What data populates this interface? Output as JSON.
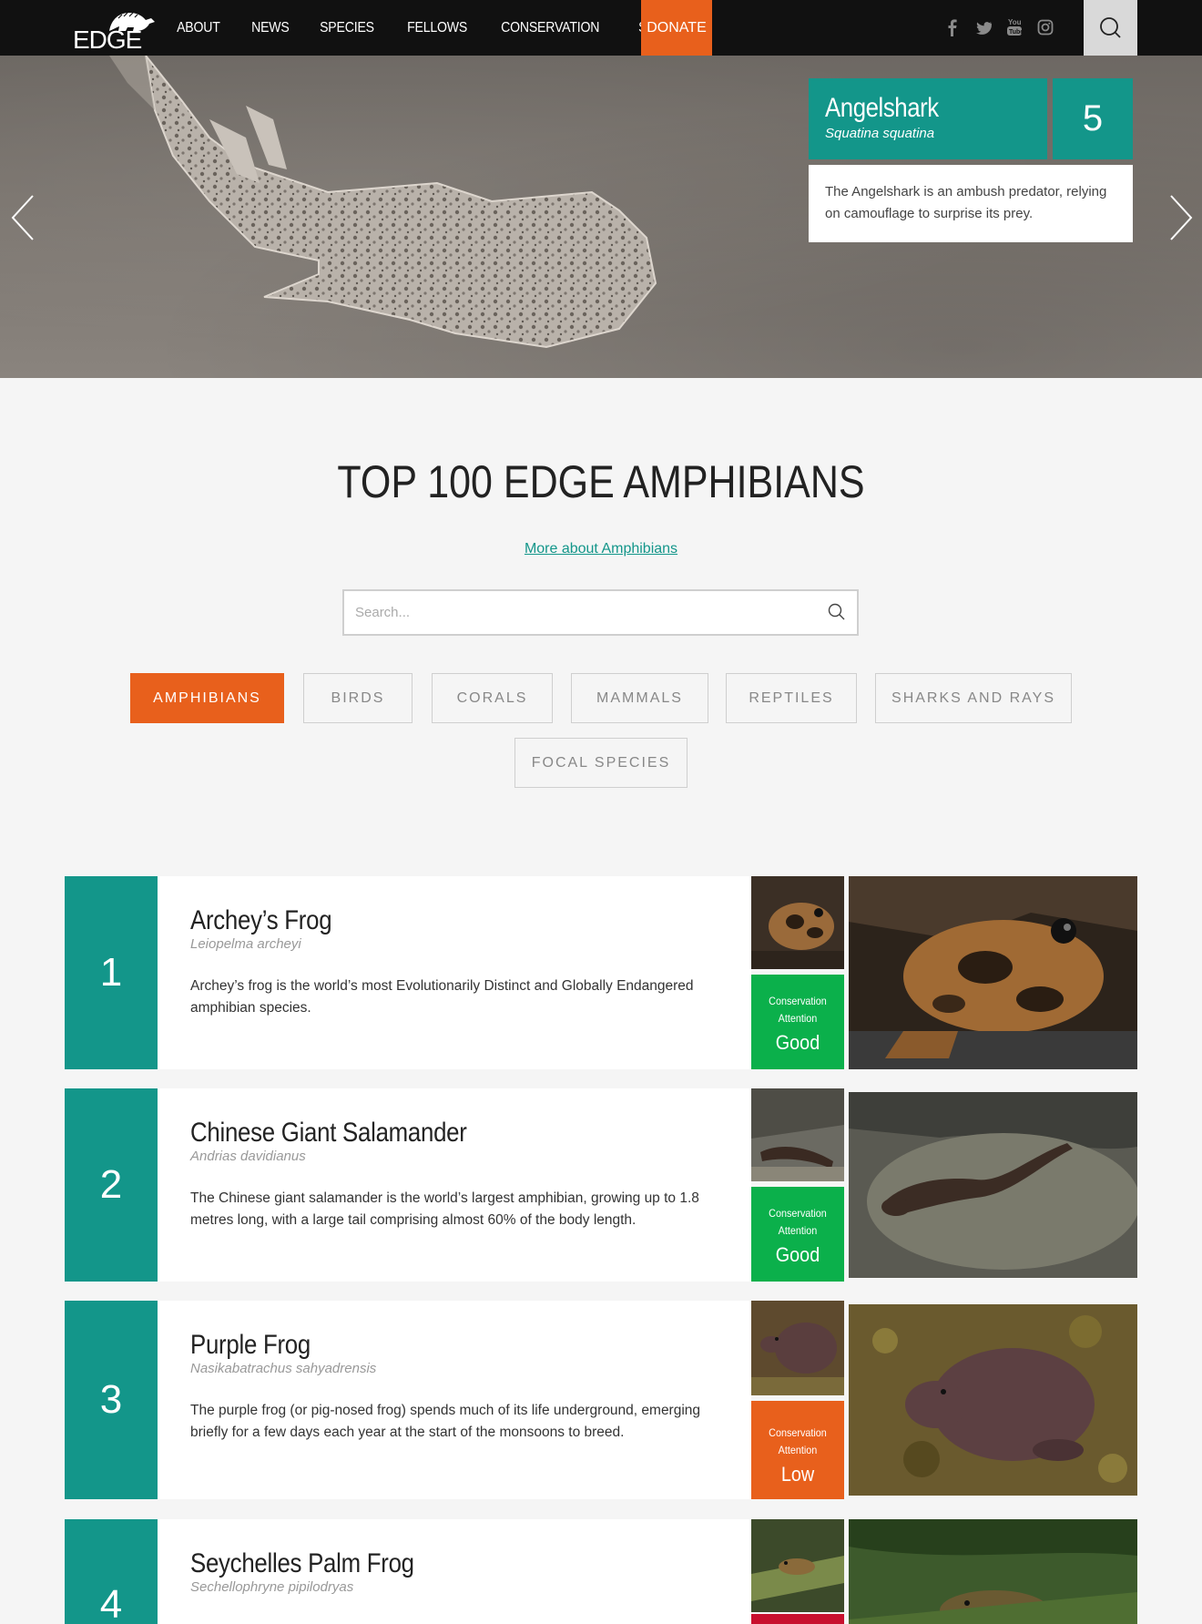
{
  "nav": {
    "logo_text": "EDGE",
    "links": [
      "ABOUT",
      "NEWS",
      "SPECIES",
      "FELLOWS",
      "CONSERVATION",
      "SUPPORT"
    ],
    "donate": "DONATE",
    "social": [
      "facebook-icon",
      "twitter-icon",
      "youtube-icon",
      "instagram-icon"
    ],
    "youtube_text": "You"
  },
  "hero": {
    "species_name": "Angelshark",
    "species_latin": "Squatina squatina",
    "rank": "5",
    "description": "The Angelshark is an ambush predator, relying on camouflage to surprise its prey."
  },
  "main": {
    "title": "TOP 100 EDGE AMPHIBIANS",
    "more_link": "More about Amphibians",
    "search_placeholder": "Search..."
  },
  "filters": [
    "AMPHIBIANS",
    "BIRDS",
    "CORALS",
    "MAMMALS",
    "REPTILES",
    "SHARKS AND RAYS",
    "FOCAL SPECIES"
  ],
  "active_filter": "AMPHIBIANS",
  "status_label": [
    "Conservation",
    "Attention"
  ],
  "species": [
    {
      "rank": "1",
      "name": "Archey’s Frog",
      "latin": "Leiopelma archeyi",
      "description": "Archey’s frog is the world’s most Evolutionarily Distinct and Globally Endangered amphibian species.",
      "attention": "Good",
      "attention_color": "#0bb04b"
    },
    {
      "rank": "2",
      "name": "Chinese Giant Salamander",
      "latin": "Andrias davidianus",
      "description": "The Chinese giant salamander is the world’s largest amphibian, growing up to 1.8 metres long, with a large tail comprising almost 60% of the body length.",
      "attention": "Good",
      "attention_color": "#0bb04b"
    },
    {
      "rank": "3",
      "name": "Purple Frog",
      "latin": "Nasikabatrachus sahyadrensis",
      "description": "The purple frog (or pig-nosed frog) spends much of its life underground, emerging briefly for a few days each year at the start of the monsoons to breed.",
      "attention": "Low",
      "attention_color": "#e8601c"
    },
    {
      "rank": "4",
      "name": "Seychelles Palm Frog",
      "latin": "Sechellophryne pipilodryas",
      "attention_color": "#c8102e"
    }
  ],
  "colors": {
    "teal": "#13968a",
    "orange": "#e8601c",
    "green": "#0bb04b",
    "red": "#c8102e"
  }
}
